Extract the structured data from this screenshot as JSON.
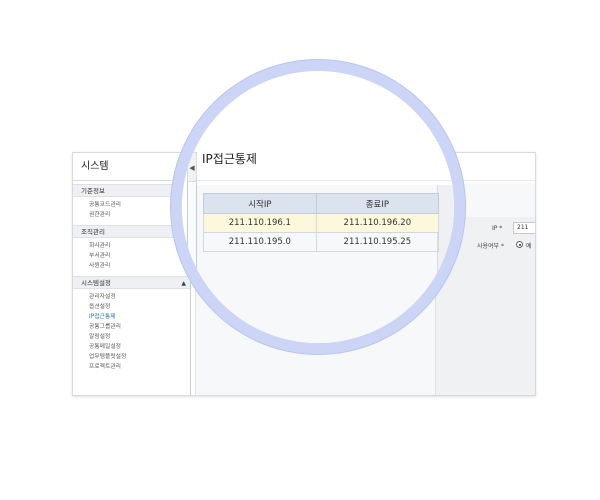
{
  "sidebar": {
    "title": "시스템",
    "collapse_icon": "◀",
    "sections": [
      {
        "label": "기준정보",
        "arrow": "▲",
        "items": [
          "공통코드관리",
          "권한관리"
        ]
      },
      {
        "label": "조직관리",
        "arrow": "▲",
        "items": [
          "회사관리",
          "부서관리",
          "사원관리"
        ]
      },
      {
        "label": "시스템설정",
        "arrow": "▲",
        "items": [
          "관리자설정",
          "옵션설정",
          "IP접근통제",
          "공통그룹관리",
          "알림설정",
          "공통메일설정",
          "업무템플릿설정",
          "프로젝트관리"
        ]
      }
    ],
    "active_item": "IP접근통제"
  },
  "main": {
    "title": "IP접근통제",
    "table": {
      "headers": [
        "시작IP",
        "종료IP"
      ],
      "rows": [
        [
          "211.110.196.1",
          "211.110.196.20"
        ],
        [
          "211.110.195.0",
          "211.110.195.25"
        ]
      ]
    },
    "form": {
      "ip_label": "IP *",
      "ip_value": "211",
      "usage_label": "사용여부 *",
      "usage_option": "예"
    }
  },
  "colors": {
    "magnifier_ring": "#ccd5f6",
    "selected_row": "#fdf7dc",
    "header_bg": "#dbe3ee",
    "active_link": "#2d6cc0"
  }
}
